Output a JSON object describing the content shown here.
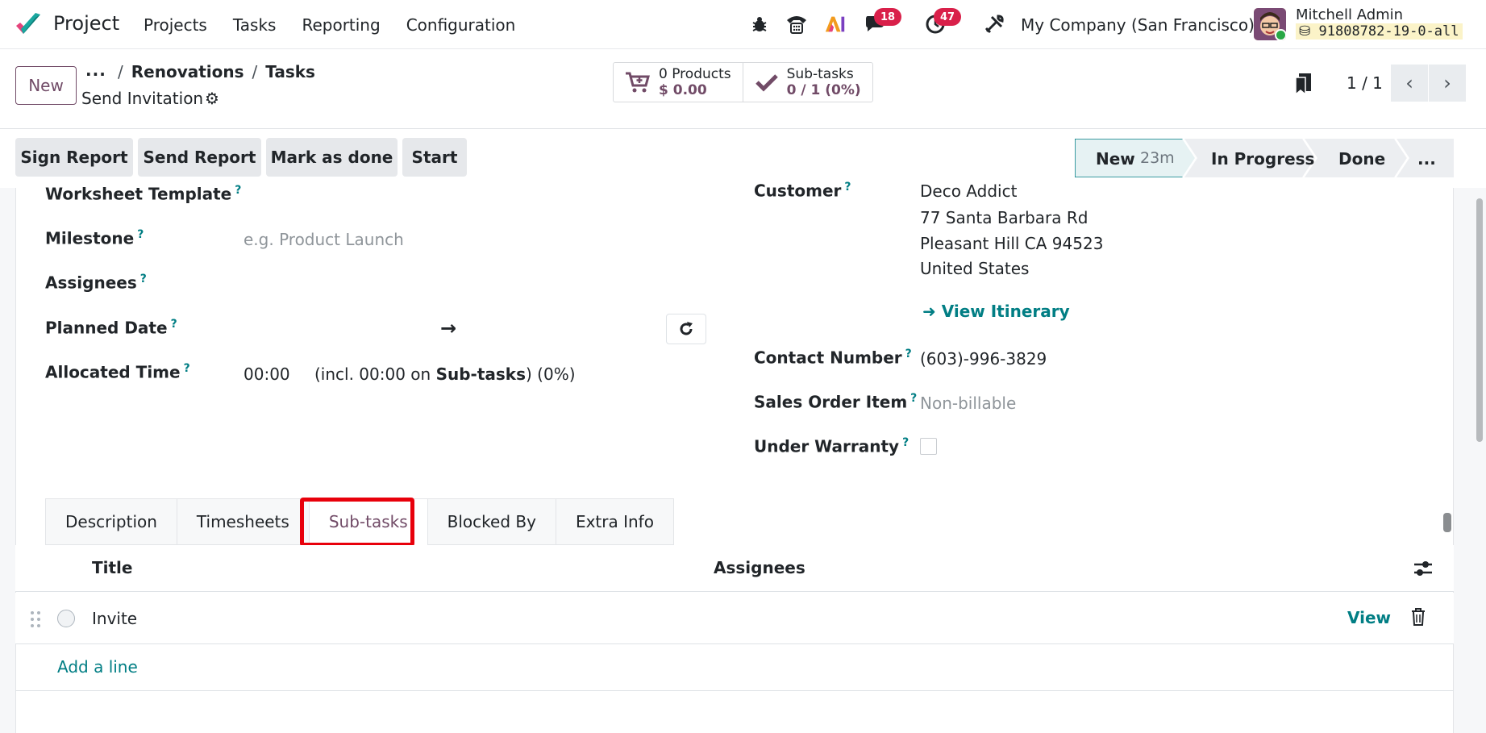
{
  "app": {
    "name": "Project",
    "menu": [
      "Projects",
      "Tasks",
      "Reporting",
      "Configuration"
    ]
  },
  "systray": {
    "messages_count": "18",
    "activities_count": "47",
    "company": "My Company (San Francisco)",
    "user_name": "Mitchell Admin",
    "db_name": "91808782-19-0-all"
  },
  "control": {
    "new_label": "New",
    "breadcrumb_more": "···",
    "breadcrumb": [
      "Renovations",
      "Tasks"
    ],
    "record_title": "Send Invitation",
    "smart_products_l1": "0 Products",
    "smart_products_l2": "$ 0.00",
    "smart_subtasks_l1": "Sub-tasks",
    "smart_subtasks_l2": "0 / 1 (0%)",
    "pager": "1 / 1"
  },
  "status": {
    "actions": [
      "Sign Report",
      "Send Report",
      "Mark as done",
      "Start"
    ],
    "stage_new": "New",
    "stage_new_time": "23m",
    "stage_progress": "In Progress",
    "stage_done": "Done",
    "stage_more": "..."
  },
  "form": {
    "worksheet_label": "Worksheet Template",
    "milestone_label": "Milestone",
    "milestone_placeholder": "e.g. Product Launch",
    "assignees_label": "Assignees",
    "planned_label": "Planned Date",
    "planned_arrow": "→",
    "allocated_label": "Allocated Time",
    "allocated_value": "00:00",
    "allocated_incl_pre": "(incl. 00:00 on ",
    "allocated_incl_bold": "Sub-tasks",
    "allocated_incl_post": ") (0%)",
    "customer_label": "Customer",
    "customer_name": "Deco Addict",
    "address_1": "77 Santa Barbara Rd",
    "address_2": "Pleasant Hill CA 94523",
    "address_3": "United States",
    "itinerary": "View Itinerary",
    "contact_label": "Contact Number",
    "contact_value": "(603)-996-3829",
    "sale_label": "Sales Order Item",
    "sale_placeholder": "Non-billable",
    "warranty_label": "Under Warranty",
    "help_mark": "?"
  },
  "tabs": [
    "Description",
    "Timesheets",
    "Sub-tasks",
    "Blocked By",
    "Extra Info"
  ],
  "subtasks": {
    "col_title": "Title",
    "col_assignees": "Assignees",
    "rows": [
      {
        "title": "Invite",
        "action": "View"
      }
    ],
    "add_line": "Add a line"
  },
  "colors": {
    "brand": "#714b67",
    "accent": "#017e84",
    "badge": "#d9204a",
    "highlight": "#e8000b"
  }
}
